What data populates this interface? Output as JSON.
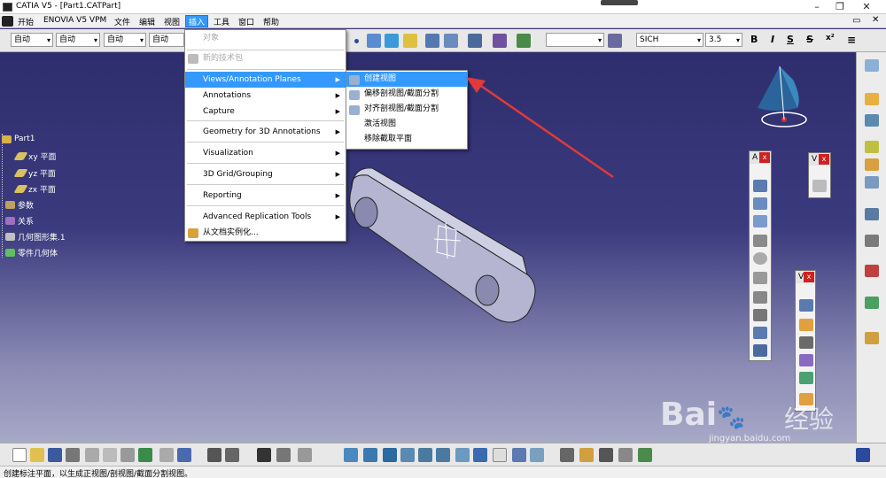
{
  "window": {
    "title": "CATIA V5 - [Part1.CATPart]"
  },
  "menubar": {
    "items": [
      "开始",
      "ENOVIA V5 VPM",
      "文件",
      "编辑",
      "视图",
      "插入",
      "工具",
      "窗口",
      "帮助"
    ],
    "active": "插入"
  },
  "toolbar": {
    "combos": [
      "自动",
      "自动",
      "自动",
      "自动"
    ],
    "font_name": "SICH",
    "font_size": "3.5",
    "bold": "B",
    "italic": "I",
    "strike_s": "S",
    "strike_s2": "S"
  },
  "tree": {
    "root": "Part1",
    "items": [
      "xy 平面",
      "yz 平面",
      "zx 平面",
      "参数",
      "关系",
      "几何图形集.1",
      "零件几何体"
    ]
  },
  "insert_menu": {
    "items": [
      {
        "label": "对象",
        "disabled": true
      },
      {
        "label": "新的技术包",
        "disabled": true
      },
      {
        "label": "Views/Annotation Planes",
        "submenu": true,
        "highlighted": true
      },
      {
        "label": "Annotations",
        "submenu": true
      },
      {
        "label": "Capture",
        "submenu": true
      },
      {
        "label": "Geometry for 3D Annotations",
        "submenu": true
      },
      {
        "label": "Visualization",
        "submenu": true
      },
      {
        "label": "3D Grid/Grouping",
        "submenu": true
      },
      {
        "label": "Reporting",
        "submenu": true
      },
      {
        "label": "Advanced Replication Tools",
        "submenu": true
      },
      {
        "label": "从文档实例化..."
      }
    ]
  },
  "views_submenu": {
    "items": [
      "创建视图",
      "偏移剖视图/截面分割",
      "对齐剖视图/截面分割",
      "激活视图",
      "移除截取平面"
    ]
  },
  "palettes": {
    "a_title": "A",
    "v1_title": "V",
    "v2_title": "V",
    "close": "x"
  },
  "watermark": {
    "brand": "Bai",
    "brand2": "经验",
    "url": "jingyan.baidu.com"
  },
  "status": "创建标注平面，以生成正视图/剖视图/截面分割视图。",
  "colors": {
    "background_top": "#2c2c6a",
    "background_bottom": "#9a9ac0",
    "highlight": "#3399ff",
    "arrow": "#e03a3a"
  }
}
